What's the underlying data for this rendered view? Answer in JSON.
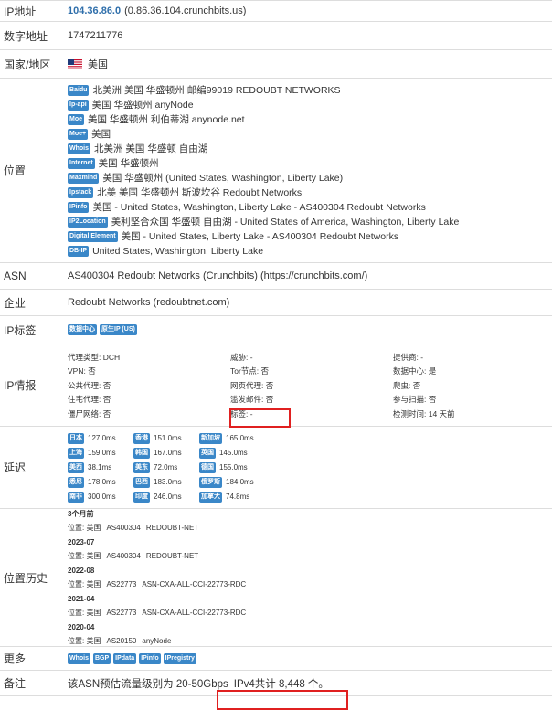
{
  "ip_row": {
    "label": "IP地址",
    "ip": "104.36.86.0",
    "host": "(0.86.36.104.crunchbits.us)"
  },
  "num_row": {
    "label": "数字地址",
    "value": "1747211776"
  },
  "country_row": {
    "label": "国家/地区",
    "value": "美国"
  },
  "location": {
    "label": "位置",
    "items": [
      {
        "src": "Baidu",
        "text": "北美洲 美国 华盛顿州 邮编99019 REDOUBT NETWORKS"
      },
      {
        "src": "Ip-api",
        "text": "美国 华盛顿州 anyNode"
      },
      {
        "src": "Moe",
        "text": "美国 华盛顿州 利伯蒂湖 anynode.net"
      },
      {
        "src": "Moe+",
        "text": "美国"
      },
      {
        "src": "Whois",
        "text": "北美洲 美国 华盛顿 自由湖"
      },
      {
        "src": "Internet",
        "text": "美国 华盛顿州"
      },
      {
        "src": "Maxmind",
        "text": "美国 华盛顿州 (United States, Washington, Liberty Lake)"
      },
      {
        "src": "Ipstack",
        "text": "北美 美国 华盛顿州 斯波坎谷 Redoubt Networks"
      },
      {
        "src": "IPinfo",
        "text": "美国 - United States, Washington, Liberty Lake - AS400304 Redoubt Networks"
      },
      {
        "src": "IP2Location",
        "text": "美利坚合众国 华盛顿 自由湖 - United States of America, Washington, Liberty Lake"
      },
      {
        "src": "Digital Element",
        "text": "美国 - United States, Liberty Lake - AS400304 Redoubt Networks"
      },
      {
        "src": "DB-IP",
        "text": "United States, Washington, Liberty Lake"
      }
    ]
  },
  "asn_row": {
    "label": "ASN",
    "value": "AS400304 Redoubt Networks (Crunchbits) (https://crunchbits.com/)"
  },
  "company_row": {
    "label": "企业",
    "value": "Redoubt Networks (redoubtnet.com)"
  },
  "tags_row": {
    "label": "IP标签",
    "tags": [
      "数据中心",
      "原生IP (US)"
    ]
  },
  "intel": {
    "label": "IP情报",
    "cells": [
      "代理类型: DCH",
      "威胁: -",
      "提供商: -",
      "VPN: 否",
      "Tor节点: 否",
      "数据中心: 是",
      "公共代理: 否",
      "网页代理: 否",
      "爬虫: 否",
      "住宅代理: 否",
      "滥发邮件: 否",
      "参与扫描: 否",
      "僵尸网络: 否",
      "标签: -",
      "检测时间: 14 天前"
    ]
  },
  "latency": {
    "label": "延迟",
    "items": [
      {
        "region": "日本",
        "ms": "127.0ms"
      },
      {
        "region": "香港",
        "ms": "151.0ms"
      },
      {
        "region": "新加坡",
        "ms": "165.0ms"
      },
      {
        "region": "上海",
        "ms": "159.0ms"
      },
      {
        "region": "韩国",
        "ms": "167.0ms"
      },
      {
        "region": "英国",
        "ms": "145.0ms"
      },
      {
        "region": "美西",
        "ms": "38.1ms"
      },
      {
        "region": "美东",
        "ms": "72.0ms"
      },
      {
        "region": "德国",
        "ms": "155.0ms"
      },
      {
        "region": "悉尼",
        "ms": "178.0ms"
      },
      {
        "region": "巴西",
        "ms": "183.0ms"
      },
      {
        "region": "俄罗斯",
        "ms": "184.0ms"
      },
      {
        "region": "南非",
        "ms": "300.0ms"
      },
      {
        "region": "印度",
        "ms": "246.0ms"
      },
      {
        "region": "加拿大",
        "ms": "74.8ms"
      }
    ]
  },
  "history": {
    "label": "位置历史",
    "entries": [
      {
        "date": "3个月前",
        "loc": "位置: 美国",
        "asn": "AS400304",
        "name": "REDOUBT-NET"
      },
      {
        "date": "2023-07",
        "loc": "位置: 美国",
        "asn": "AS400304",
        "name": "REDOUBT-NET"
      },
      {
        "date": "2022-08",
        "loc": "位置: 美国",
        "asn": "AS22773",
        "name": "ASN-CXA-ALL-CCI-22773-RDC"
      },
      {
        "date": "2021-04",
        "loc": "位置: 美国",
        "asn": "AS22773",
        "name": "ASN-CXA-ALL-CCI-22773-RDC"
      },
      {
        "date": "2020-04",
        "loc": "位置: 美国",
        "asn": "AS20150",
        "name": "anyNode"
      }
    ]
  },
  "more_row": {
    "label": "更多",
    "links": [
      "Whois",
      "BGP",
      "IPdata",
      "IPinfo",
      "IPregistry"
    ]
  },
  "note_row": {
    "label": "备注",
    "text1": "该ASN预估流量级别为 20-50Gbps",
    "text2": "IPv4共计 8,448 个。"
  },
  "colors": {
    "accent": "#3a87c8",
    "link": "#2f6fab",
    "highlight": "#e02020"
  }
}
